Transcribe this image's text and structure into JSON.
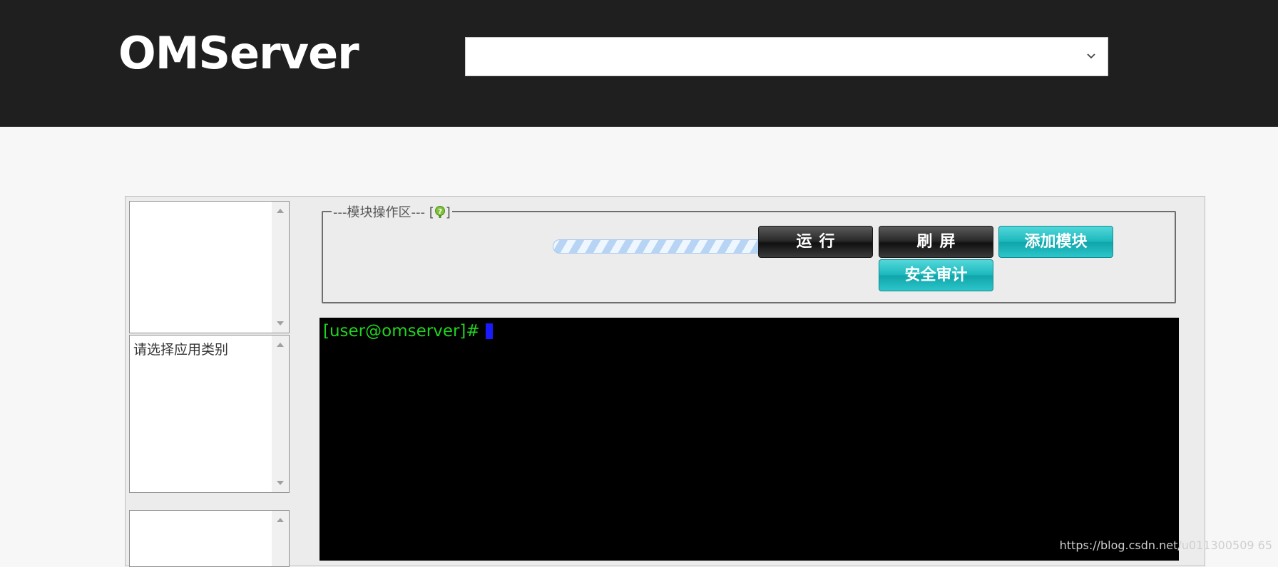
{
  "header": {
    "brand": "OMServer",
    "server_select": {
      "selected": ""
    }
  },
  "sidebar": {
    "category_placeholder": "请选择应用类别"
  },
  "module_area": {
    "legend": "---模块操作区--- [",
    "legend_end": "]",
    "buttons": {
      "run": "运行",
      "refresh": "刷屏",
      "add_module": "添加模块",
      "security_audit": "安全审计"
    }
  },
  "terminal": {
    "prompt": "[user@omserver]#"
  },
  "watermark": "https://blog.csdn.net/u011300509 65",
  "colors": {
    "header_bg": "#1f1f1f",
    "terminal_prompt": "#1fd41f",
    "teal_button": "#1cb9bd"
  }
}
